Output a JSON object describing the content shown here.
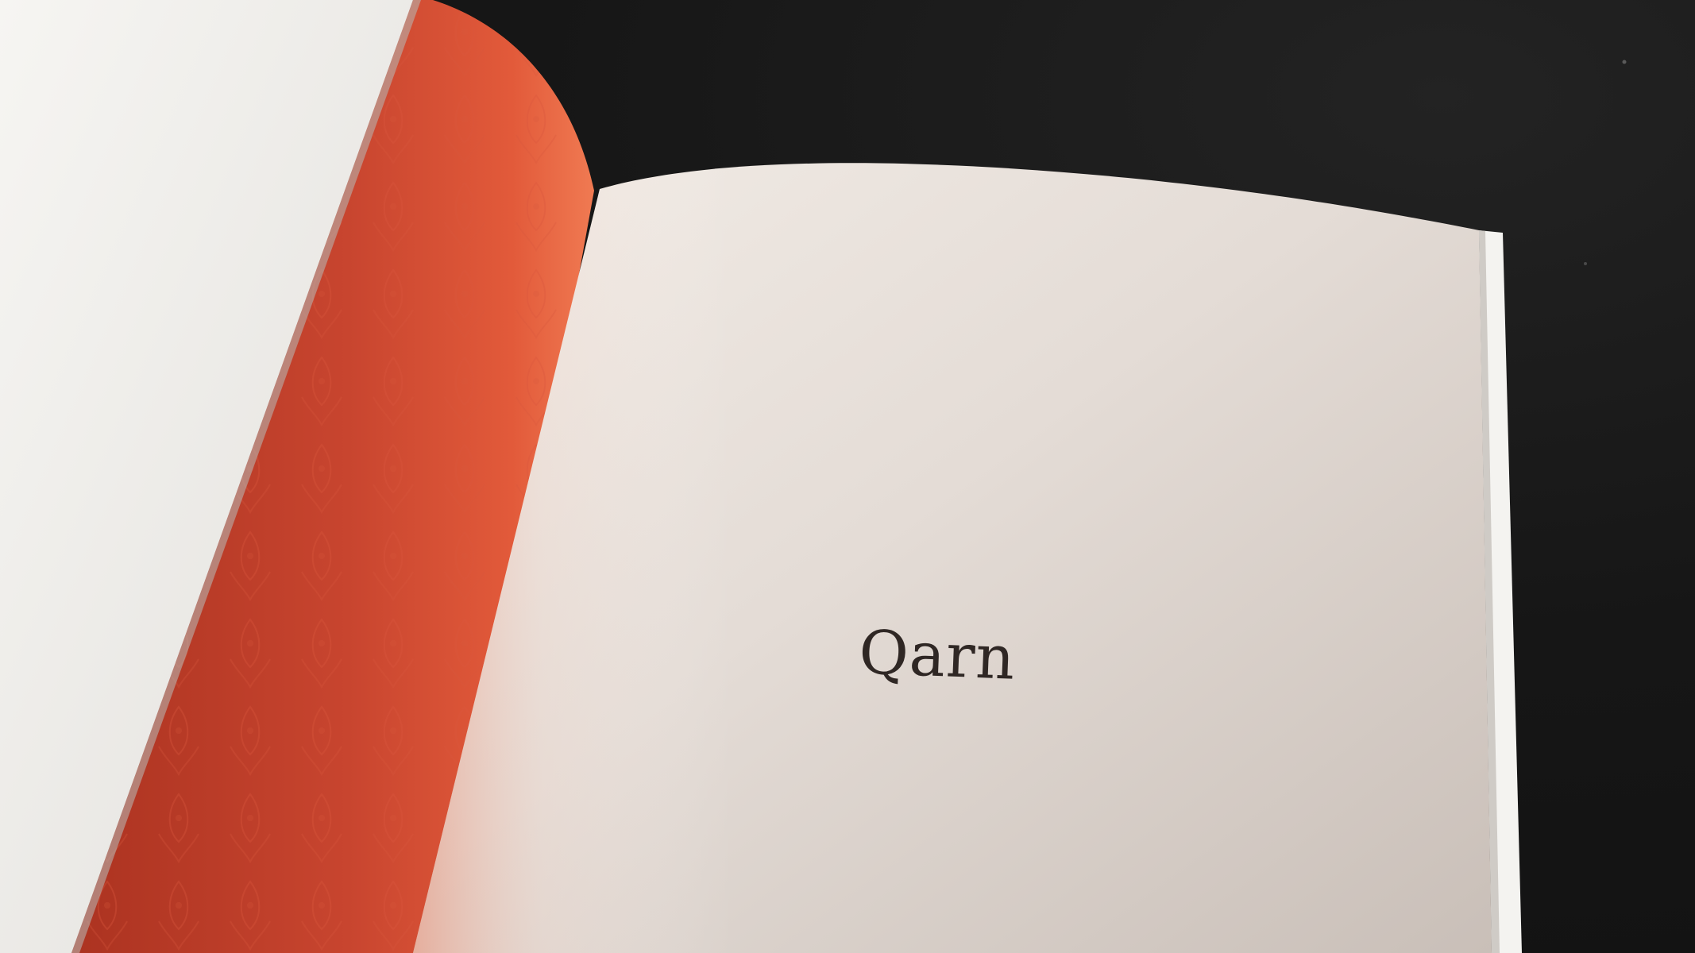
{
  "photo": {
    "subject": "open-book",
    "page_text": "Qarn"
  },
  "colors": {
    "background": "#151515",
    "endpaper": "#c8452f",
    "page": "#e3dcd6",
    "cover": "#f1efec",
    "ink": "#2f2724"
  }
}
